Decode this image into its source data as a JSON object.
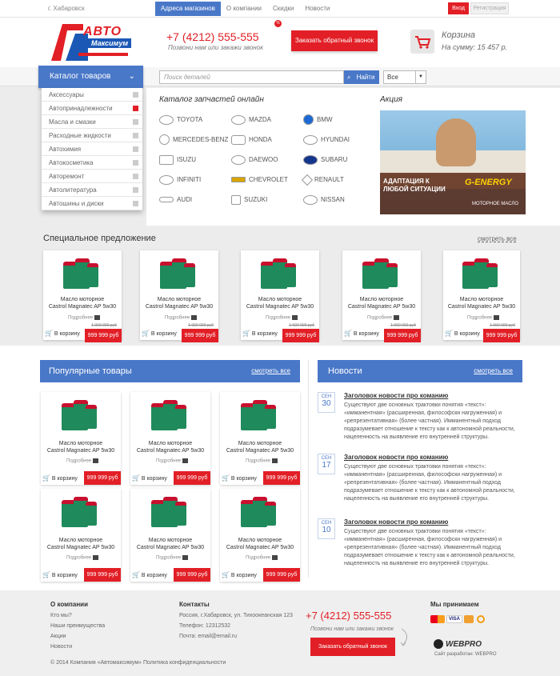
{
  "topbar": {
    "city": "г. Хабаровск",
    "nav": [
      "Адреса магазинов",
      "О компании",
      "Скидки",
      "Новости"
    ],
    "discount_badge": "%",
    "login": "Вход",
    "register": "Регистрация"
  },
  "header": {
    "logo_line1": "АВТО",
    "logo_line2": "Максимум",
    "phone": "+7 (4212) 555-555",
    "phone_sub": "Позвони нам или закажи звонок",
    "callback_btn": "Заказать обратный звонок",
    "cart_title": "Корзина",
    "cart_sum": "На сумму: 15 457 р."
  },
  "catalog": {
    "button": "Каталог товаров",
    "items": [
      "Аксессуары",
      "Автопринадлежности",
      "Масла и смазки",
      "Расходные жидкости",
      "Автохимия",
      "Автокосметика",
      "Авторемонт",
      "Автолитература",
      "Автошины и диски"
    ]
  },
  "search": {
    "placeholder": "Поиск деталей",
    "button": "Найти",
    "select_value": "Все"
  },
  "parts": {
    "title": "Каталог запчастей онлайн",
    "brands": [
      [
        "TOYOTA",
        "MAZDA",
        "BMW"
      ],
      [
        "MERCEDES-BENZ",
        "HONDA",
        "HYUNDAI"
      ],
      [
        "ISUZU",
        "DAEWOO",
        "SUBARU"
      ],
      [
        "INFINITI",
        "CHEVROLET",
        "RENAULT"
      ],
      [
        "AUDI",
        "SUZUKI",
        "NISSAN"
      ]
    ]
  },
  "promo": {
    "title": "Акция",
    "text": "АДАПТАЦИЯ К ЛЮБОЙ СИТУАЦИИ",
    "brand": "G-ENERGY",
    "sub": "МОТОРНОЕ МАСЛО"
  },
  "special": {
    "title": "Специальное предложение",
    "see_all": "смотреть все"
  },
  "product": {
    "name_line1": "Масло моторное",
    "name_line2": "Castrol Magnatec AP 5w30",
    "more": "Подробнее",
    "to_cart": "В корзину",
    "old_price": "1 000 000 руб",
    "price": "999 999 руб"
  },
  "popular": {
    "title": "Популярные товары",
    "see_all": "смотреть все"
  },
  "news": {
    "title": "Новости",
    "see_all": "смотреть все",
    "items": [
      {
        "month": "СЕН",
        "day": "30",
        "title": "Заголовок новости про команию",
        "text": "Существуют две основных трактовки понятия «текст»: «имманентная» (расширенная, философски нагруженная) и «репрезентативная» (более частная). Имманентный подход подразумевает отношение к тексту как к автономной реальности, нацеленность на выявление его внутренней структуры."
      },
      {
        "month": "СЕН",
        "day": "17",
        "title": "Заголовок новости про команию",
        "text": "Существуют две основных трактовки понятия «текст»: «имманентная» (расширенная, философски нагруженная) и «репрезентативная» (более частная). Имманентный подход подразумевает отношение к тексту как к автономной реальности, нацеленность на выявление его внутренней структуры."
      },
      {
        "month": "СЕН",
        "day": "10",
        "title": "Заголовок новости про команию",
        "text": "Существуют две основных трактовки понятия «текст»: «имманентная» (расширенная, философски нагруженная) и «репрезентативная» (более частная). Имманентный подход подразумевает отношение к тексту как к автономной реальности, нацеленность на выявление его внутренней структуры."
      }
    ]
  },
  "footer": {
    "about_title": "О компании",
    "about_links": [
      "Кто мы?",
      "Наши преимущества",
      "Акции",
      "Новости"
    ],
    "contacts_title": "Контакты",
    "address": "Россия, г.Хабаровск,  ул. Тихоокеанская 123",
    "phone_line": "Телефон: 12312532",
    "email_line": "Почта: email@email.ru",
    "phone": "+7 (4212) 555-555",
    "phone_sub": "Позвони нам или закажи звонок",
    "callback_btn": "Заказать обратный звонок",
    "pay_title": "Мы принимаем",
    "pay_methods": [
      "mastercard-icon",
      "visa-icon",
      "webmoney-icon",
      "qiwi-icon"
    ],
    "dev_logo": "WEBPRO",
    "dev_text": "Сайт разработан: WEBPRO",
    "copyright": "© 2014 Компания «Автомаксимум» Политика конфиденциальности"
  },
  "colors": {
    "accent": "#4a78c8",
    "brand_red": "#e21f26",
    "band": "#ececec"
  }
}
